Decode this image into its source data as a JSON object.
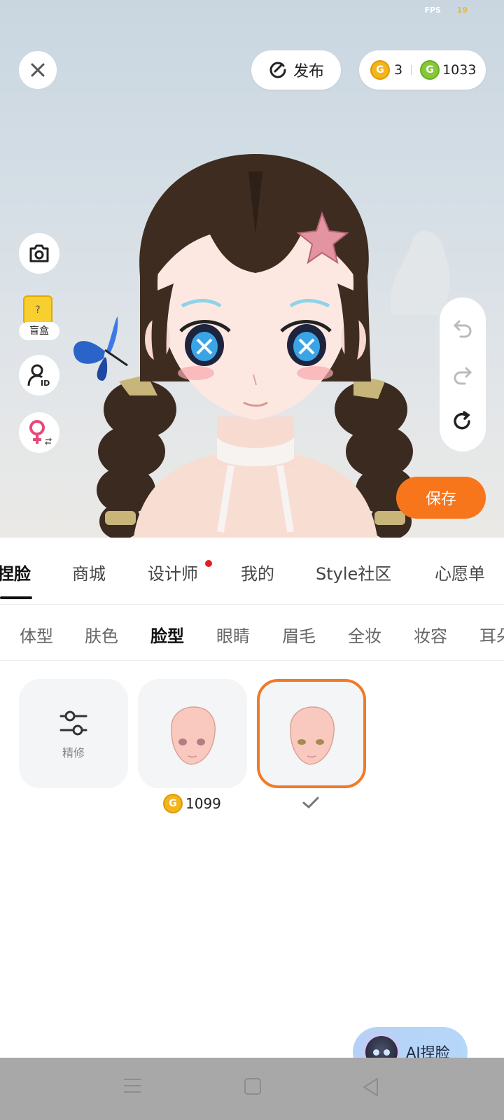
{
  "status": {
    "fps_label": "FPS",
    "fps_value": "19"
  },
  "top_bar": {
    "publish_label": "发布",
    "gold_count": "3",
    "green_count": "1033",
    "coin_letter": "G"
  },
  "side_tools": {
    "blind_box_label": "盲盒",
    "blind_box_mark": "?"
  },
  "save_label": "保存",
  "main_tabs": [
    {
      "label": "捏脸"
    },
    {
      "label": "商城"
    },
    {
      "label": "设计师"
    },
    {
      "label": "我的"
    },
    {
      "label": "Style社区"
    },
    {
      "label": "心愿单"
    }
  ],
  "sub_tabs": [
    {
      "label": "体型"
    },
    {
      "label": "肤色"
    },
    {
      "label": "脸型"
    },
    {
      "label": "眼睛"
    },
    {
      "label": "眉毛"
    },
    {
      "label": "全妆"
    },
    {
      "label": "妆容"
    },
    {
      "label": "耳朵"
    }
  ],
  "items": {
    "refine_label": "精修",
    "price": "1099"
  },
  "ai_button_label": "AI捏脸",
  "colors": {
    "accent": "#f7761c",
    "selected_border": "#f07a28"
  }
}
